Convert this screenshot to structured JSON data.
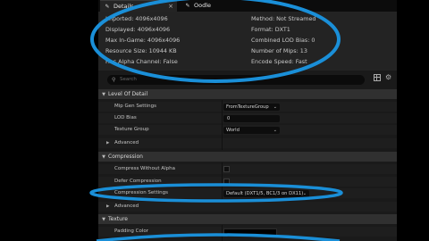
{
  "tabs": {
    "details_label": "Details",
    "close_glyph": "×",
    "oodle_label": "Oodle"
  },
  "info": {
    "imported": "Imported: 4096x4096",
    "displayed": "Displayed: 4096x4096",
    "max_in_game": "Max In-Game: 4096x4096",
    "resource_size": "Resource Size: 10944 KB",
    "has_alpha": "Has Alpha Channel: False",
    "method": "Method: Not Streamed",
    "format": "Format: DXT1",
    "combined_lod_bias": "Combined LOD Bias: 0",
    "num_mips": "Number of Mips: 13",
    "encode_speed": "Encode Speed: Fast"
  },
  "search": {
    "placeholder": "Search"
  },
  "sections": {
    "level_of_detail": {
      "title": "Level Of Detail",
      "mip_gen_label": "Mip Gen Settings",
      "mip_gen_value": "FromTextureGroup",
      "lod_bias_label": "LOD Bias",
      "lod_bias_value": "0",
      "texture_group_label": "Texture Group",
      "texture_group_value": "World",
      "advanced_label": "Advanced"
    },
    "compression": {
      "title": "Compression",
      "compress_without_alpha_label": "Compress Without Alpha",
      "compress_without_alpha_checked": false,
      "defer_compression_label": "Defer Compression",
      "defer_compression_checked": false,
      "compression_settings_label": "Compression Settings",
      "compression_settings_value": "Default (DXT1/5, BC1/3 on DX11)",
      "advanced_label": "Advanced"
    },
    "texture": {
      "title": "Texture",
      "padding_color_label": "Padding Color"
    }
  },
  "icons": {
    "details": "pencil-icon",
    "oodle": "brush-icon",
    "search": "search-icon",
    "view_options": "grid-icon",
    "settings": "gear-icon",
    "expanded": "triangle-down-icon",
    "collapsed": "triangle-right-icon",
    "dropdown": "chevron-down-icon"
  },
  "colors": {
    "annotation": "#1a8fd8",
    "panel_bg": "#1a1a1a",
    "section_bg": "#303030"
  }
}
